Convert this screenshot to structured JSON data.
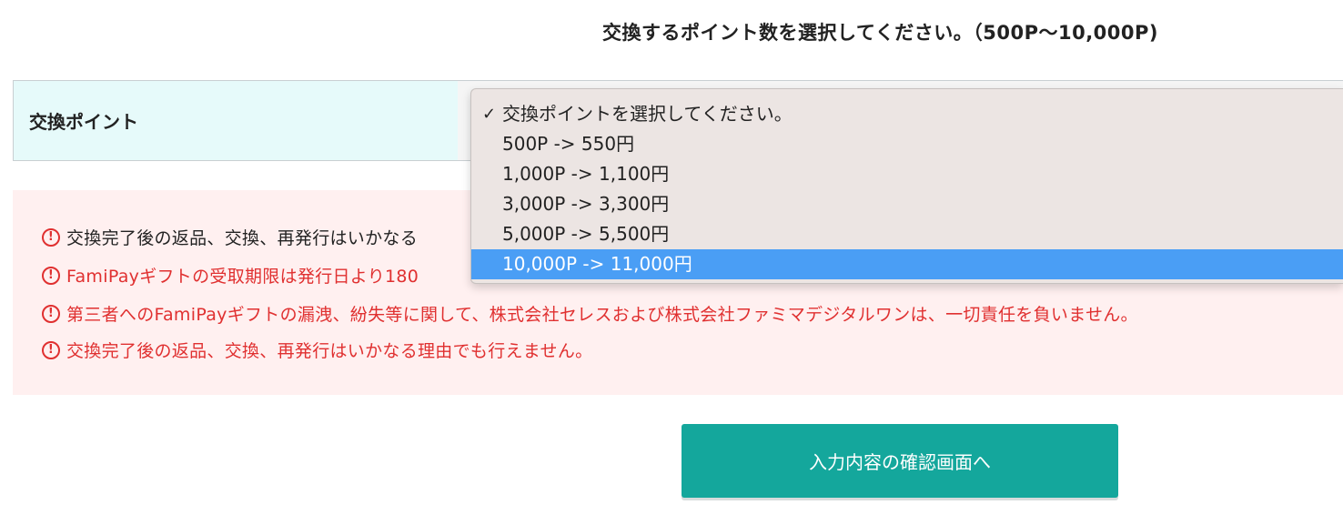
{
  "instruction": "交換するポイント数を選択してください。（500P〜10,000P)",
  "form": {
    "label": "交換ポイント"
  },
  "dropdown": {
    "options": [
      {
        "label": "交換ポイントを選択してください。",
        "checked": true,
        "highlighted": false
      },
      {
        "label": "500P -> 550円",
        "checked": false,
        "highlighted": false
      },
      {
        "label": "1,000P -> 1,100円",
        "checked": false,
        "highlighted": false
      },
      {
        "label": "3,000P -> 3,300円",
        "checked": false,
        "highlighted": false
      },
      {
        "label": "5,000P -> 5,500円",
        "checked": false,
        "highlighted": false
      },
      {
        "label": "10,000P -> 11,000円",
        "checked": false,
        "highlighted": true
      }
    ],
    "check_icon": "✓",
    "highlight_color": "#4a9ef5"
  },
  "notices": [
    {
      "text": "交換完了後の返品、交換、再発行はいかなる",
      "color": "black"
    },
    {
      "text": "FamiPayギフトの受取期限は発行日より180",
      "color": "red"
    },
    {
      "text": "第三者へのFamiPayギフトの漏洩、紛失等に関して、株式会社セレスおよび株式会社ファミマデジタルワンは、一切責任を負いません。",
      "color": "red"
    },
    {
      "text": "交換完了後の返品、交換、再発行はいかなる理由でも行えません。",
      "color": "red"
    }
  ],
  "warning_icon": "!",
  "confirm_button": {
    "label": "入力内容の確認画面へ",
    "color": "#14a79c"
  }
}
